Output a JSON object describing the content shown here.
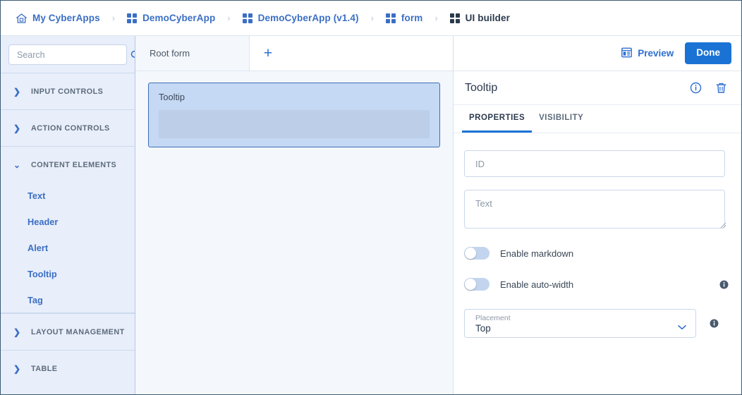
{
  "breadcrumb": {
    "items": [
      {
        "label": "My CyberApps",
        "icon": "home-icon",
        "current": false
      },
      {
        "label": "DemoCyberApp",
        "icon": "grid-icon",
        "current": false
      },
      {
        "label": "DemoCyberApp (v1.4)",
        "icon": "grid-icon",
        "current": false
      },
      {
        "label": "form",
        "icon": "grid-icon",
        "current": false
      },
      {
        "label": "UI builder",
        "icon": "grid-icon",
        "current": true
      }
    ],
    "separator": "›"
  },
  "sidebar": {
    "search": {
      "placeholder": "Search",
      "value": "",
      "icon": "search-icon"
    },
    "sections": [
      {
        "label": "INPUT CONTROLS",
        "expanded": false,
        "items": []
      },
      {
        "label": "ACTION CONTROLS",
        "expanded": false,
        "items": []
      },
      {
        "label": "CONTENT ELEMENTS",
        "expanded": true,
        "items": [
          {
            "label": "Text"
          },
          {
            "label": "Header"
          },
          {
            "label": "Alert"
          },
          {
            "label": "Tooltip"
          },
          {
            "label": "Tag"
          }
        ]
      },
      {
        "label": "LAYOUT MANAGEMENT",
        "expanded": false,
        "items": []
      },
      {
        "label": "TABLE",
        "expanded": false,
        "items": []
      }
    ]
  },
  "canvas": {
    "tabs": [
      {
        "label": "Root form",
        "active": true
      }
    ],
    "add_tab_label": "+",
    "widget": {
      "title": "Tooltip"
    }
  },
  "actions": {
    "preview_label": "Preview",
    "preview_icon": "preview-icon",
    "done_label": "Done"
  },
  "properties": {
    "title": "Tooltip",
    "info_icon": "info-circle-icon",
    "delete_icon": "trash-icon",
    "tabs": [
      {
        "label": "PROPERTIES",
        "active": true
      },
      {
        "label": "VISIBILITY",
        "active": false
      }
    ],
    "fields": {
      "id": {
        "placeholder": "ID",
        "value": ""
      },
      "text": {
        "placeholder": "Text",
        "value": ""
      },
      "enable_markdown": {
        "label": "Enable markdown",
        "on": false,
        "has_info": false
      },
      "enable_auto_width": {
        "label": "Enable auto-width",
        "on": false,
        "has_info": true
      },
      "placement": {
        "caption": "Placement",
        "value": "Top",
        "has_info": true,
        "caret_icon": "chevron-down-icon"
      }
    }
  },
  "colors": {
    "accent": "#1a73d4",
    "link": "#3b6fc4",
    "sidebar_bg": "#e8eefa",
    "canvas_bg": "#f4f8fd",
    "widget_fill": "#c5d9f5",
    "widget_border": "#3f6fb5",
    "widget_slot": "#bccee8"
  }
}
